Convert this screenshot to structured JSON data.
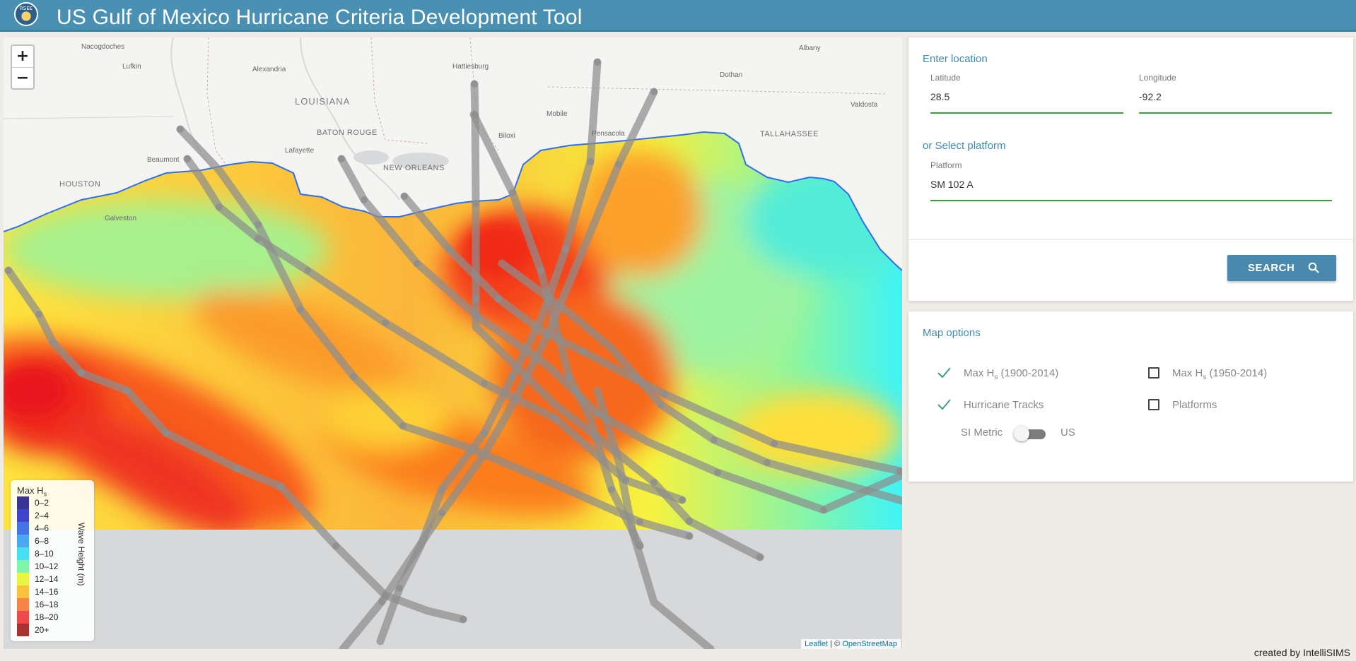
{
  "header": {
    "logo_text": "RSEE",
    "title": "US Gulf of Mexico Hurricane Criteria Development Tool"
  },
  "map": {
    "zoom_in": "+",
    "zoom_out": "−",
    "places": {
      "nacogdoches": "Nacogdoches",
      "lufkin": "Lufkin",
      "alexandria": "Alexandria",
      "hattiesburg": "Hattiesburg",
      "albany": "Albany",
      "dothan": "Dothan",
      "louisiana": "LOUISIANA",
      "mobile": "Mobile",
      "valdosta": "Valdosta",
      "baton_rouge": "BATON ROUGE",
      "biloxi": "Biloxi",
      "pensacola": "Pensacola",
      "tallahassee": "TALLAHASSEE",
      "beaumont": "Beaumont",
      "lafayette": "Lafayette",
      "new_orleans": "NEW ORLEANS",
      "houston": "HOUSTON",
      "galveston": "Galveston"
    },
    "attribution_leaflet": "Leaflet",
    "attribution_sep": " | © ",
    "attribution_osm": "OpenStreetMap",
    "legend": {
      "title": "Max H",
      "title_sub": "s",
      "axis_label": "Wave Height (m)",
      "items": [
        {
          "label": "0–2",
          "color": "#3a3496"
        },
        {
          "label": "2–4",
          "color": "#3f45c8"
        },
        {
          "label": "4–6",
          "color": "#4673e6"
        },
        {
          "label": "6–8",
          "color": "#4aa8f0"
        },
        {
          "label": "8–10",
          "color": "#47e0f2"
        },
        {
          "label": "10–12",
          "color": "#7ef5a8"
        },
        {
          "label": "12–14",
          "color": "#e8f542"
        },
        {
          "label": "14–16",
          "color": "#fbc23d"
        },
        {
          "label": "16–18",
          "color": "#f78346"
        },
        {
          "label": "18–20",
          "color": "#ef4a4a"
        },
        {
          "label": "20+",
          "color": "#a83232"
        }
      ]
    }
  },
  "location": {
    "heading": "Enter location",
    "latitude_label": "Latitude",
    "latitude_value": "28.5",
    "longitude_label": "Longitude",
    "longitude_value": "-92.2",
    "platform_heading": "or Select platform",
    "platform_label": "Platform",
    "platform_value": "SM 102 A",
    "search_label": "SEARCH"
  },
  "map_options": {
    "heading": "Map options",
    "opt1_label": "Max H",
    "opt1_sub": "s",
    "opt1_range": " (1900-2014)",
    "opt1_checked": true,
    "opt2_label": "Max H",
    "opt2_sub": "s",
    "opt2_range": " (1950-2014)",
    "opt2_checked": false,
    "opt3_label": "Hurricane Tracks",
    "opt3_checked": true,
    "opt4_label": "Platforms",
    "opt4_checked": false,
    "units_left": "SI Metric",
    "units_right": "US",
    "units_us_selected": false
  },
  "footer": {
    "credit": "created by IntelliSIMS"
  }
}
